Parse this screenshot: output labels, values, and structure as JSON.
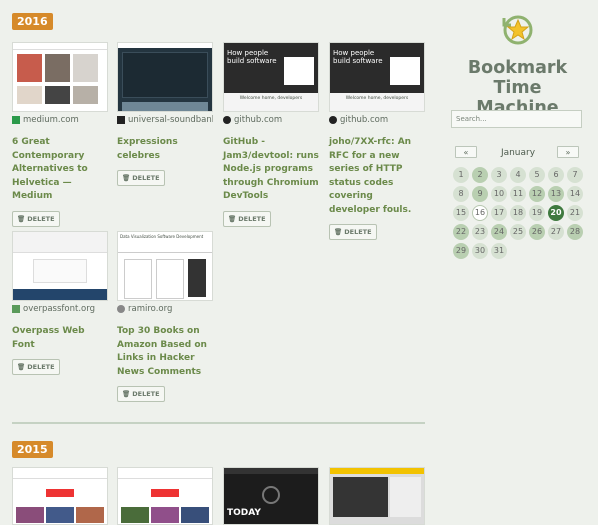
{
  "years": [
    "2016",
    "2015"
  ],
  "bookmarks_2016": [
    {
      "source": "medium.com",
      "title": "6 Great Contemporary Alternatives to Helvetica — Medium",
      "delete": "DELETE"
    },
    {
      "source": "universal-soundbank...",
      "title": "Expressions celebres",
      "delete": "DELETE"
    },
    {
      "source": "github.com",
      "title": "GitHub - Jam3/devtool: runs Node.js programs through Chromium DevTools",
      "delete": "DELETE"
    },
    {
      "source": "github.com",
      "title": "joho/7XX-rfc: An RFC for a new series of HTTP status codes covering developer fouls.",
      "delete": "DELETE"
    },
    {
      "source": "overpassfont.org",
      "title": "Overpass Web Font",
      "delete": "DELETE"
    },
    {
      "source": "ramiro.org",
      "title": "Top 30 Books on Amazon Based on Links in Hacker News Comments",
      "delete": "DELETE"
    }
  ],
  "sidebar": {
    "app_title_line1": "Bookmark",
    "app_title_line2": "Time Machine",
    "search_placeholder": "Search...",
    "month": "January",
    "prev": "«",
    "next": "»",
    "days": [
      "1",
      "2",
      "3",
      "4",
      "5",
      "6",
      "7",
      "8",
      "9",
      "10",
      "11",
      "12",
      "13",
      "14",
      "15",
      "16",
      "17",
      "18",
      "19",
      "20",
      "21",
      "22",
      "23",
      "24",
      "25",
      "26",
      "27",
      "28",
      "29",
      "30",
      "31"
    ],
    "selected_day": "20",
    "today_day": "16",
    "highlight_days": [
      "2",
      "9",
      "12",
      "13",
      "22",
      "24",
      "26",
      "28",
      "29"
    ]
  },
  "colors": {
    "year_badge": "#d68a2a",
    "link": "#6b8a4a",
    "selected": "#3f7a3f"
  }
}
